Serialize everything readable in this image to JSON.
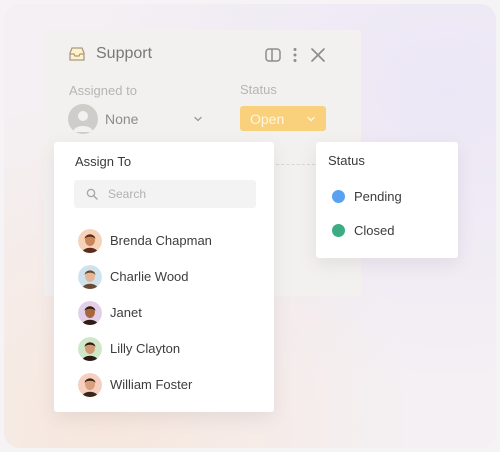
{
  "card": {
    "title": "Support",
    "assigned_label": "Assigned to",
    "assigned_value": "None",
    "status_label": "Status",
    "status_value": "Open"
  },
  "assign_popover": {
    "title": "Assign To",
    "search_placeholder": "Search",
    "users": [
      {
        "name": "Brenda Chapman",
        "avatar_bg": "#f6d2b8",
        "skin": "#c8865a",
        "hair": "#5a2c1a"
      },
      {
        "name": "Charlie Wood",
        "avatar_bg": "#cfe3ee",
        "skin": "#e3b797",
        "hair": "#6b4a33"
      },
      {
        "name": "Janet",
        "avatar_bg": "#e2cfe9",
        "skin": "#a8663f",
        "hair": "#2d1c17"
      },
      {
        "name": "Lilly Clayton",
        "avatar_bg": "#cfe6c9",
        "skin": "#d29a74",
        "hair": "#2a1a14"
      },
      {
        "name": "William Foster",
        "avatar_bg": "#f6cfc1",
        "skin": "#d8a07c",
        "hair": "#3a2518"
      }
    ]
  },
  "status_popover": {
    "title": "Status",
    "options": [
      {
        "label": "Pending",
        "color": "#5aa2f1"
      },
      {
        "label": "Closed",
        "color": "#3dac82"
      }
    ]
  },
  "colors": {
    "accent": "#f9d07c"
  }
}
